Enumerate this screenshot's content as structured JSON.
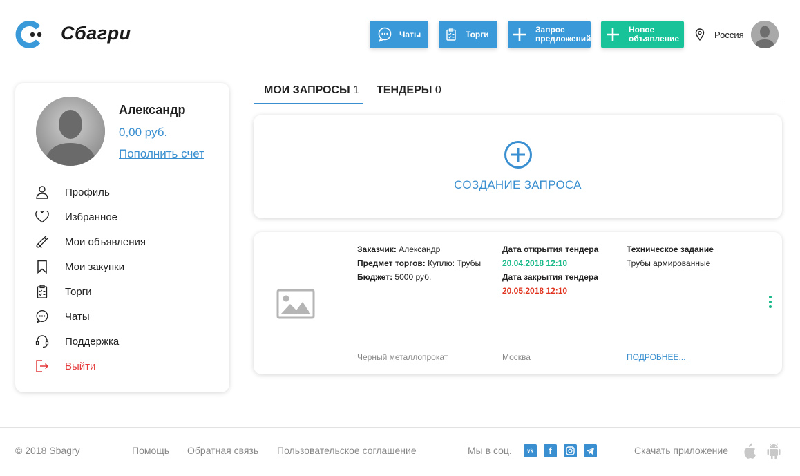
{
  "colors": {
    "accent": "#3a8fd0",
    "button_blue": "#3a9ad9",
    "button_green": "#19c39a",
    "success": "#19b98a",
    "danger": "#e0321e",
    "muted": "#888888"
  },
  "header": {
    "logo_icon": "sbagri-logo-icon",
    "brand": "Сбагри",
    "buttons": {
      "chats": "Чаты",
      "torgi": "Торги",
      "request": "Запрос\nпредложений",
      "new_ad": "Новое\nобъявление"
    },
    "location": "Россия"
  },
  "sidebar": {
    "user_name": "Александр",
    "balance": "0,00 руб.",
    "topup": "Пополнить счет",
    "menu": [
      {
        "label": "Профиль",
        "icon": "user-icon"
      },
      {
        "label": "Избранное",
        "icon": "heart-icon"
      },
      {
        "label": "Мои объявления",
        "icon": "megaphone-icon"
      },
      {
        "label": "Мои закупки",
        "icon": "bookmark-icon"
      },
      {
        "label": "Торги",
        "icon": "clipboard-icon"
      },
      {
        "label": "Чаты",
        "icon": "chat-icon"
      },
      {
        "label": "Поддержка",
        "icon": "headset-icon"
      },
      {
        "label": "Выйти",
        "icon": "logout-icon"
      }
    ]
  },
  "tabs": [
    {
      "label": "МОИ ЗАПРОСЫ",
      "count": "1"
    },
    {
      "label": "ТЕНДЕРЫ",
      "count": "0"
    }
  ],
  "create_request": {
    "label": "СОЗДАНИЕ ЗАПРОСА"
  },
  "request": {
    "customer_label": "Заказчик:",
    "customer": "Александр",
    "subject_label": "Предмет торгов:",
    "subject": "Куплю: Трубы",
    "budget_label": "Бюджет:",
    "budget": "5000 руб.",
    "open_label": "Дата открытия тендера",
    "open_date": "20.04.2018 12:10",
    "close_label": "Дата закрытия тендера",
    "close_date": "20.05.2018 12:10",
    "spec_label": "Техническое задание",
    "spec": "Трубы армированные",
    "category": "Черный металлопрокат",
    "city": "Москва",
    "more": "ПОДРОБНЕЕ..."
  },
  "footer": {
    "copyright": "© 2018 Sbagry",
    "help": "Помощь",
    "feedback": "Обратная связь",
    "terms": "Пользовательское соглашение",
    "social_label": "Мы в соц.",
    "vk": "vk",
    "fb": "f",
    "download": "Скачать приложение"
  }
}
